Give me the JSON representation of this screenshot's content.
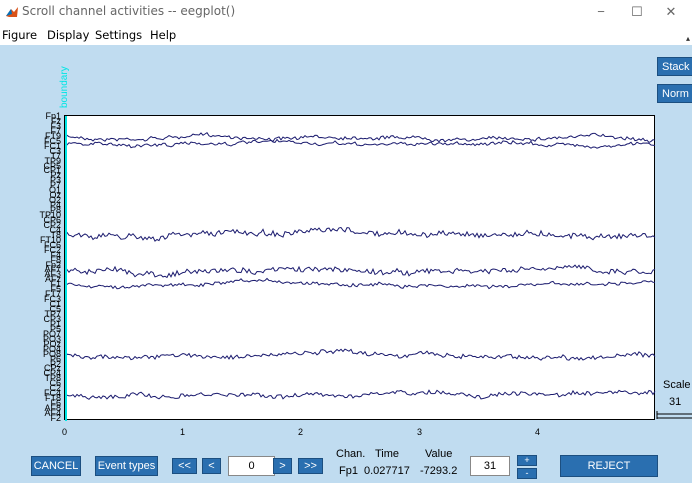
{
  "window": {
    "title": "Scroll channel activities -- eegplot()",
    "minimize": "−",
    "maximize": "☐",
    "close": "✕"
  },
  "menu": [
    "Figure",
    "Display",
    "Settings",
    "Help"
  ],
  "menu_overflow": "▴",
  "plot": {
    "boundary_label": "boundary",
    "channels": [
      "Fp1",
      "Fz",
      "F3",
      "F7",
      "FT9",
      "FC5",
      "FC1",
      "C3",
      "T7",
      "TP9",
      "CP5",
      "CP1",
      "Pz",
      "P3",
      "P7",
      "O1",
      "Oz",
      "O2",
      "P4",
      "P8",
      "TP10",
      "CP6",
      "CP2",
      "C4",
      "T8",
      "FT10",
      "FC6",
      "FC2",
      "F4",
      "F8",
      "Fp2",
      "AF7",
      "AF3",
      "AFz",
      "F1",
      "F5",
      "FT7",
      "FC3",
      "C1",
      "C5",
      "TP7",
      "CP3",
      "P1",
      "P5",
      "PO7",
      "PO3",
      "POz",
      "PO4",
      "PO8",
      "P6",
      "P2",
      "CPz",
      "CP4",
      "TP8",
      "C6",
      "C2",
      "FC4",
      "FT8",
      "F6",
      "AF8",
      "AF4",
      "F2"
    ],
    "x_ticks": [
      "0",
      "1",
      "2",
      "3",
      "4"
    ],
    "colors": {
      "trace": "#1a1a6e",
      "boundary": "#00e5e5",
      "background": "#c0dcf0"
    }
  },
  "side": {
    "stack_label": "Stack",
    "norm_label": "Norm",
    "scale_label": "Scale",
    "scale_value": "31"
  },
  "bottom": {
    "cancel_label": "CANCEL",
    "event_types_label": "Event types",
    "first_label": "<<",
    "prev_label": "<",
    "time_value": "0",
    "next_label": ">",
    "last_label": ">>",
    "chan_header": "Chan.",
    "time_header": "Time",
    "value_header": "Value",
    "chan_value": "Fp1",
    "time_readout": "0.027717",
    "value_readout": "-7293.2",
    "scale_input": "31",
    "plus_label": "+",
    "minus_label": "-",
    "reject_label": "REJECT"
  }
}
